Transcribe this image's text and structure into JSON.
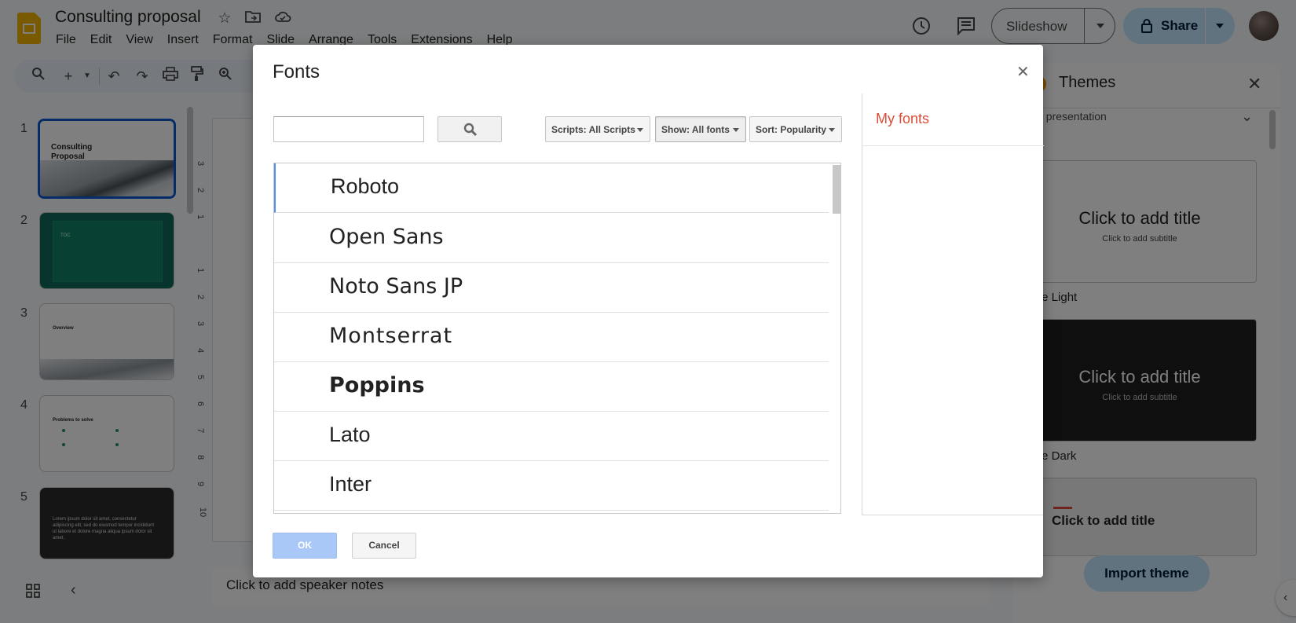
{
  "doc": {
    "title": "Consulting proposal"
  },
  "menu": [
    "File",
    "Edit",
    "View",
    "Insert",
    "Format",
    "Slide",
    "Arrange",
    "Tools",
    "Extensions",
    "Help"
  ],
  "header": {
    "slideshow_label": "Slideshow",
    "share_label": "Share"
  },
  "filmstrip": {
    "slides": [
      {
        "num": "1",
        "title": "Consulting Proposal"
      },
      {
        "num": "2",
        "title": "TOC"
      },
      {
        "num": "3",
        "title": "Overview"
      },
      {
        "num": "4",
        "title": "Problems to solve"
      },
      {
        "num": "5",
        "title": "Lorem ipsum dolor sit amet, consectetur adipiscing elit, sed do eiusmod tempor incididunt ut labore et dolore magna aliqua ipsum dolor sit amet."
      }
    ]
  },
  "ruler": [
    "3",
    "2",
    "1",
    "1",
    "2",
    "3",
    "4",
    "5",
    "6",
    "7",
    "8",
    "9",
    "10"
  ],
  "notes": {
    "placeholder": "Click to add speaker notes"
  },
  "themes": {
    "title": "Themes",
    "filter": "his presentation",
    "cards": [
      {
        "title": "Click to add title",
        "subtitle": "Click to add subtitle",
        "name": "mple Light",
        "bg": "#ffffff",
        "fg": "#1f1f1f"
      },
      {
        "title": "Click to add title",
        "subtitle": "Click to add subtitle",
        "name": "mple Dark",
        "bg": "#1e1e1e",
        "fg": "#ffffff"
      },
      {
        "title": "Click to add title",
        "subtitle": "",
        "name": "",
        "bg": "#f1f1f1",
        "fg": "#222222"
      }
    ],
    "import_label": "Import theme"
  },
  "dialog": {
    "title": "Fonts",
    "search": {
      "value": "",
      "placeholder": ""
    },
    "scripts_label": "Scripts: All Scripts",
    "show_label": "Show: All fonts",
    "sort_label": "Sort: Popularity",
    "fonts": [
      {
        "name": "Roboto",
        "family": "\"Liberation Sans\", sans-serif",
        "weight": "normal"
      },
      {
        "name": "Open Sans",
        "family": "\"DejaVu Sans\", sans-serif",
        "weight": "normal"
      },
      {
        "name": "Noto Sans JP",
        "family": "\"DejaVu Sans\", sans-serif",
        "weight": "normal"
      },
      {
        "name": "Montserrat",
        "family": "\"DejaVu Sans\", sans-serif",
        "weight": "normal"
      },
      {
        "name": "Poppins",
        "family": "\"DejaVu Sans\", sans-serif",
        "weight": "bold"
      },
      {
        "name": "Lato",
        "family": "\"Liberation Sans\", sans-serif",
        "weight": "normal"
      },
      {
        "name": "Inter",
        "family": "\"Liberation Sans\", sans-serif",
        "weight": "normal"
      }
    ],
    "my_fonts_label": "My fonts",
    "ok_label": "OK",
    "cancel_label": "Cancel"
  },
  "colors": {
    "accent": "#0b57d0",
    "share_bg": "#c2e7ff",
    "my_fonts": "#dd4b39",
    "teal_slide": "#0f6b5c"
  }
}
